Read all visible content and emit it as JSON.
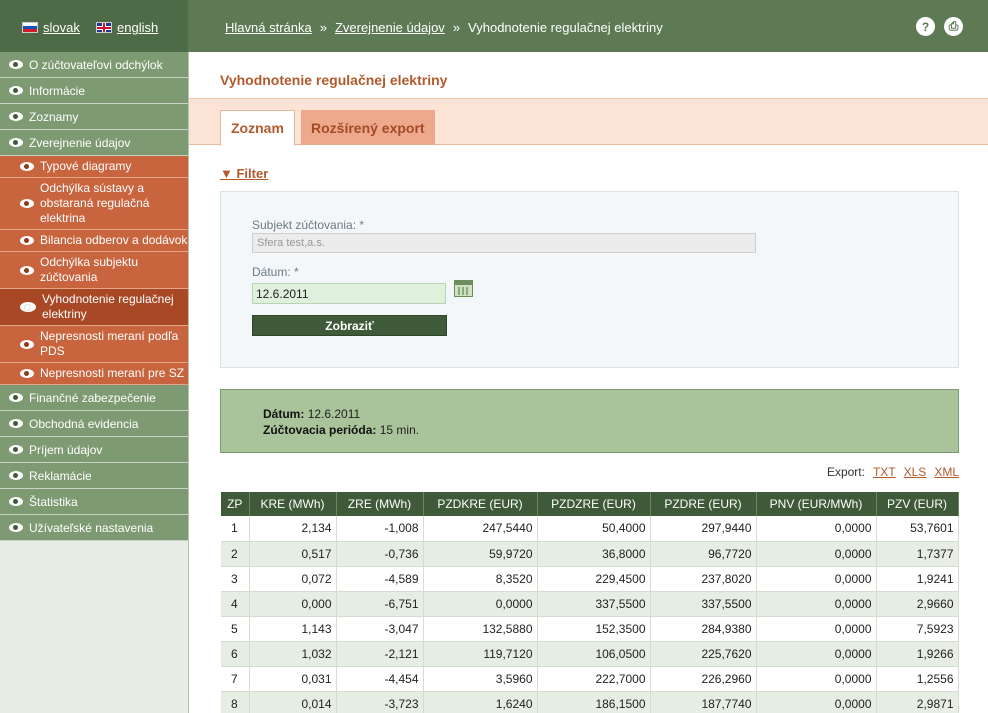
{
  "languages": [
    {
      "label": "slovak"
    },
    {
      "label": "english"
    }
  ],
  "breadcrumb": {
    "items": [
      "Hlavná stránka",
      "Zverejnenie údajov"
    ],
    "separator": "»",
    "current": "Vyhodnotenie regulačnej elektriny"
  },
  "top_icons": {
    "help": "?",
    "print": "⎙"
  },
  "sidebar": {
    "items": [
      {
        "label": "O zúčtovateľovi odchýlok",
        "level": 1
      },
      {
        "label": "Informácie",
        "level": 1
      },
      {
        "label": "Zoznamy",
        "level": 1
      },
      {
        "label": "Zverejnenie údajov",
        "level": 1
      },
      {
        "label": "Typové diagramy",
        "level": 2
      },
      {
        "label": "Odchýlka sústavy a obstaraná regulačná elektrina",
        "level": 2
      },
      {
        "label": "Bilancia odberov a dodávok",
        "level": 2
      },
      {
        "label": "Odchýlka subjektu zúčtovania",
        "level": 2
      },
      {
        "label": "Vyhodnotenie regulačnej elektriny",
        "level": 2,
        "active": true
      },
      {
        "label": "Nepresnosti meraní podľa PDS",
        "level": 2
      },
      {
        "label": "Nepresnosti meraní pre SZ",
        "level": 2
      },
      {
        "label": "Finančné zabezpečenie",
        "level": 1
      },
      {
        "label": "Obchodná evidencia",
        "level": 1
      },
      {
        "label": "Príjem údajov",
        "level": 1
      },
      {
        "label": "Reklamácie",
        "level": 1
      },
      {
        "label": "Štatistika",
        "level": 1
      },
      {
        "label": "Užívateľské nastavenia",
        "level": 1
      }
    ]
  },
  "page": {
    "title": "Vyhodnotenie regulačnej elektriny"
  },
  "tabs": [
    {
      "label": "Zoznam",
      "active": true
    },
    {
      "label": "Rozšírený export",
      "active": false
    }
  ],
  "filter": {
    "toggle_label": "▼ Filter",
    "subject_label": "Subjekt zúčtovania: *",
    "subject_value": "Sfera test,a.s.",
    "date_label": "Dátum: *",
    "date_value": "12.6.2011",
    "submit_label": "Zobraziť"
  },
  "info": {
    "date_label": "Dátum:",
    "date_value": "12.6.2011",
    "period_label": "Zúčtovacia perióda:",
    "period_value": "15 min."
  },
  "export": {
    "label": "Export:",
    "formats": [
      "TXT",
      "XLS",
      "XML"
    ]
  },
  "table": {
    "columns": [
      "ZP",
      "KRE (MWh)",
      "ZRE (MWh)",
      "PZDKRE (EUR)",
      "PZDZRE (EUR)",
      "PZDRE (EUR)",
      "PNV (EUR/MWh)",
      "PZV (EUR)"
    ],
    "rows": [
      [
        "1",
        "2,134",
        "-1,008",
        "247,5440",
        "50,4000",
        "297,9440",
        "0,0000",
        "53,7601"
      ],
      [
        "2",
        "0,517",
        "-0,736",
        "59,9720",
        "36,8000",
        "96,7720",
        "0,0000",
        "1,7377"
      ],
      [
        "3",
        "0,072",
        "-4,589",
        "8,3520",
        "229,4500",
        "237,8020",
        "0,0000",
        "1,9241"
      ],
      [
        "4",
        "0,000",
        "-6,751",
        "0,0000",
        "337,5500",
        "337,5500",
        "0,0000",
        "2,9660"
      ],
      [
        "5",
        "1,143",
        "-3,047",
        "132,5880",
        "152,3500",
        "284,9380",
        "0,0000",
        "7,5923"
      ],
      [
        "6",
        "1,032",
        "-2,121",
        "119,7120",
        "106,0500",
        "225,7620",
        "0,0000",
        "1,9266"
      ],
      [
        "7",
        "0,031",
        "-4,454",
        "3,5960",
        "222,7000",
        "226,2960",
        "0,0000",
        "1,2556"
      ],
      [
        "8",
        "0,014",
        "-3,723",
        "1,6240",
        "186,1500",
        "187,7740",
        "0,0000",
        "2,9871"
      ]
    ]
  }
}
